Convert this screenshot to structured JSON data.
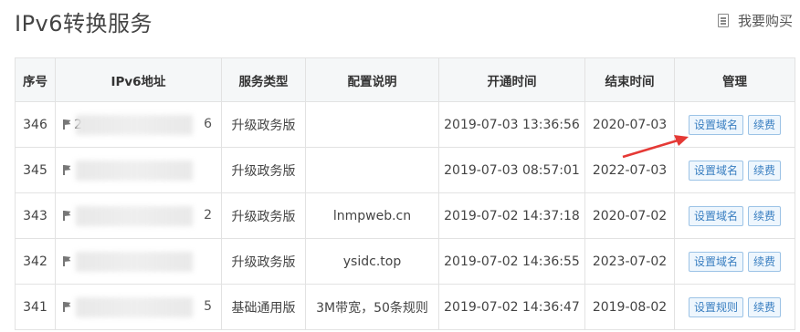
{
  "header": {
    "title": "IPv6转换服务",
    "buy_label": "我要购买"
  },
  "table": {
    "columns": [
      "序号",
      "IPv6地址",
      "服务类型",
      "配置说明",
      "开通时间",
      "结束时间",
      "管理"
    ],
    "rows": [
      {
        "id": "346",
        "ip_head": "2",
        "ip_tail": "6",
        "type": "升级政务版",
        "config": "",
        "start": "2019-07-03 13:36:56",
        "end": "2020-07-03",
        "action1": "设置域名",
        "action2": "续费"
      },
      {
        "id": "345",
        "ip_head": "",
        "ip_tail": "",
        "type": "升级政务版",
        "config": "",
        "start": "2019-07-03 08:57:01",
        "end": "2022-07-03",
        "action1": "设置域名",
        "action2": "续费"
      },
      {
        "id": "343",
        "ip_head": "",
        "ip_tail": "2",
        "type": "升级政务版",
        "config": "lnmpweb.cn",
        "start": "2019-07-02 14:37:18",
        "end": "2020-07-02",
        "action1": "设置域名",
        "action2": "续费"
      },
      {
        "id": "342",
        "ip_head": "",
        "ip_tail": "",
        "type": "升级政务版",
        "config": "ysidc.top",
        "start": "2019-07-02 14:36:55",
        "end": "2023-07-02",
        "action1": "设置域名",
        "action2": "续费"
      },
      {
        "id": "341",
        "ip_head": "",
        "ip_tail": "5",
        "type": "基础通用版",
        "config": "3M带宽，50条规则",
        "start": "2019-07-02 14:36:47",
        "end": "2019-08-02",
        "action1": "设置规则",
        "action2": "续费"
      }
    ]
  },
  "colors": {
    "accent": "#3a7fc1",
    "arrow": "#e53935",
    "header_bg": "#f5f7f8"
  }
}
